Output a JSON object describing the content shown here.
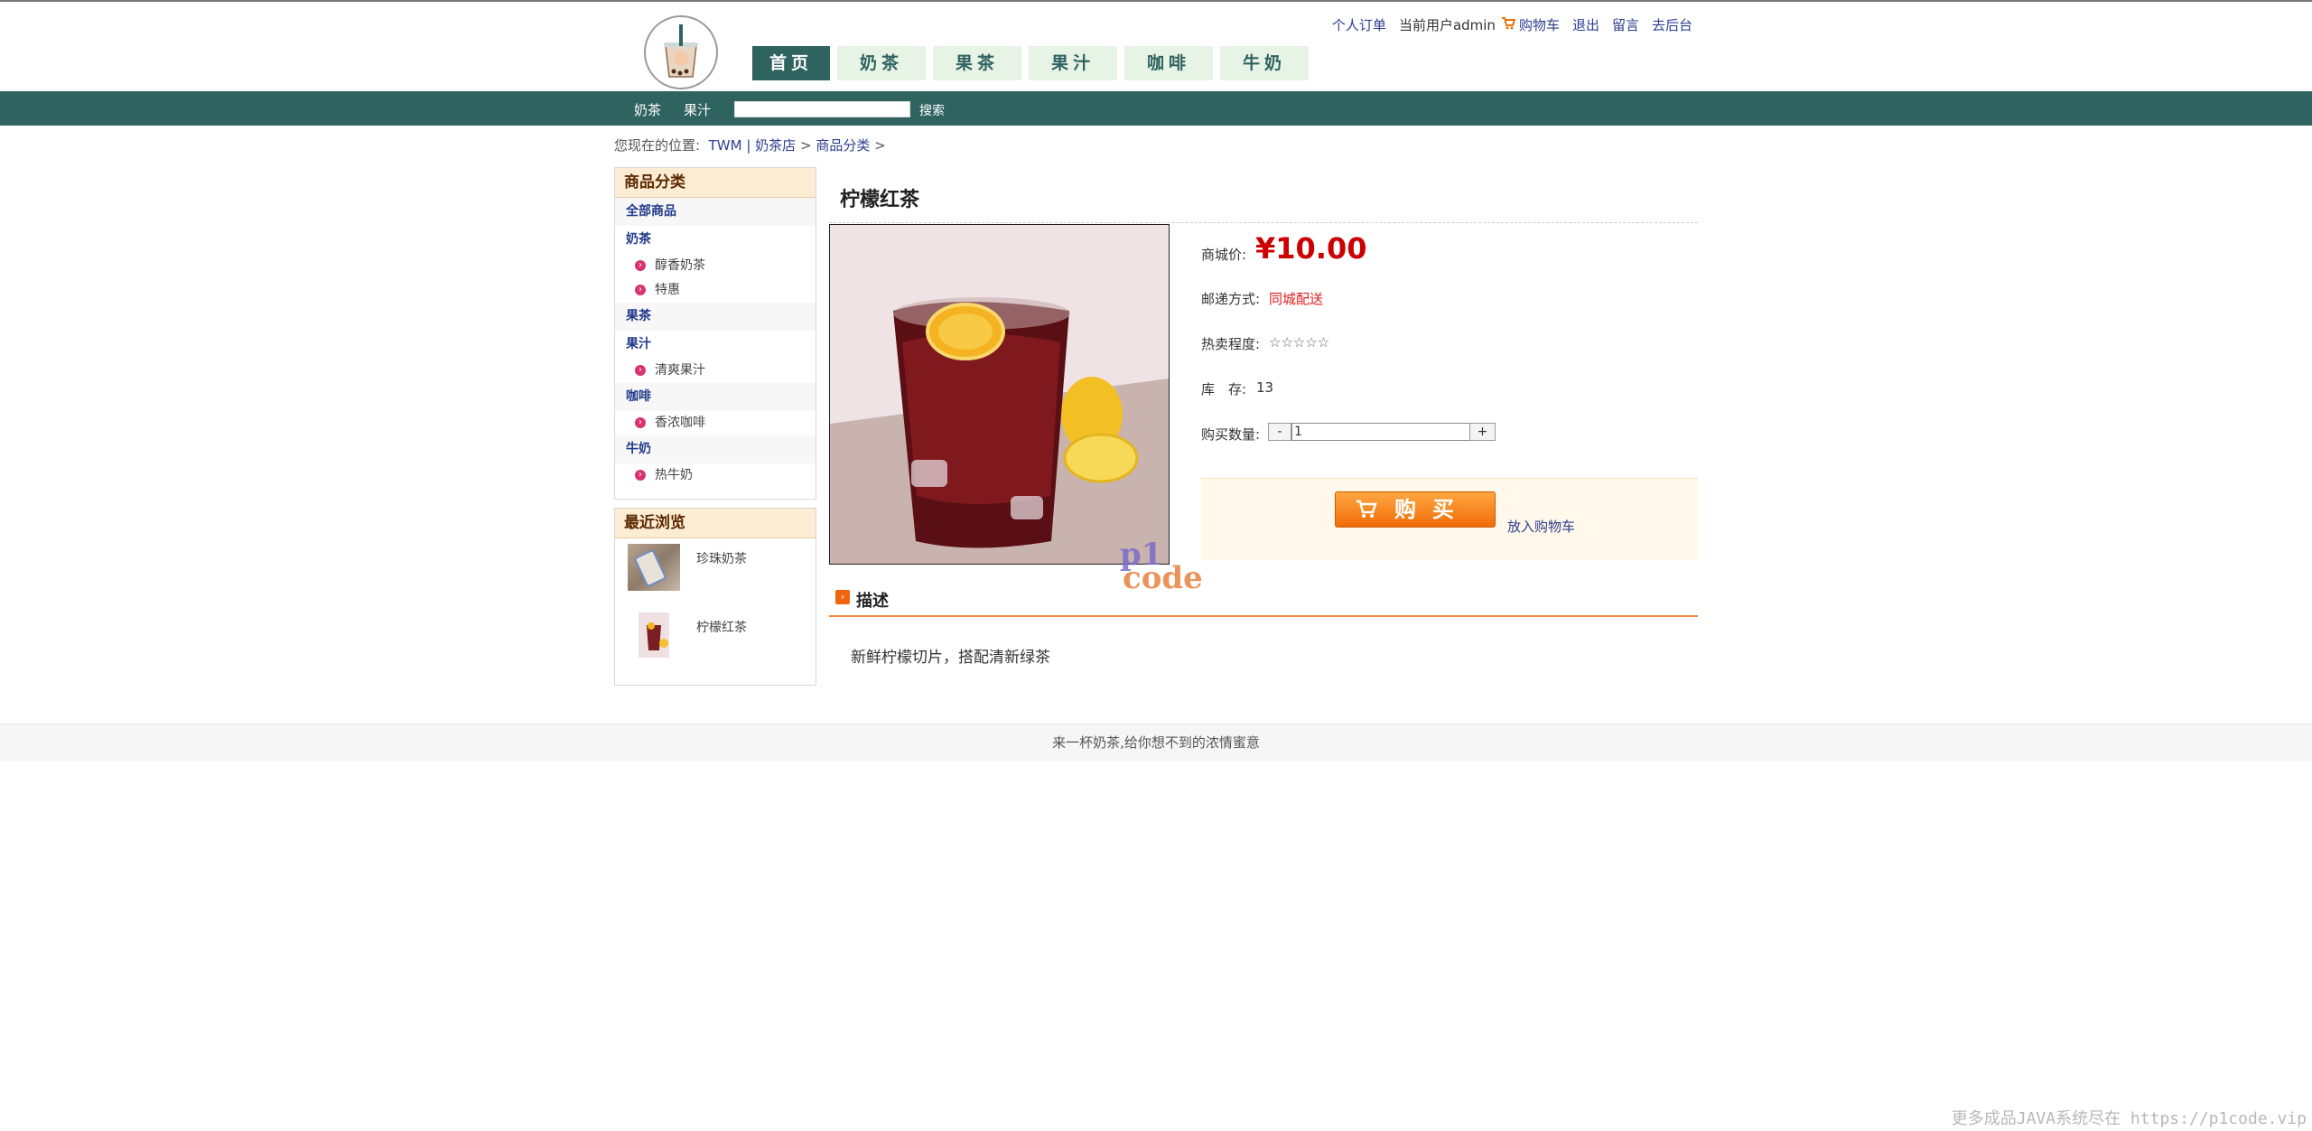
{
  "header": {
    "nav": [
      "首页",
      "奶茶",
      "果茶",
      "果汁",
      "咖啡",
      "牛奶"
    ],
    "links": {
      "orders": "个人订单",
      "current_user": "当前用户admin",
      "cart": "购物车",
      "logout": "退出",
      "message": "留言",
      "admin": "去后台"
    }
  },
  "searchbar": {
    "quick": [
      "奶茶",
      "果汁"
    ],
    "input_value": "",
    "button": "搜索"
  },
  "breadcrumb": {
    "prefix": "您现在的位置:",
    "items": [
      "TWM",
      "奶茶店",
      "商品分类"
    ],
    "sep1": "|",
    "sep": ">"
  },
  "sidebar": {
    "category_title": "商品分类",
    "categories": [
      {
        "label": "全部商品",
        "subs": []
      },
      {
        "label": "奶茶",
        "subs": [
          "醇香奶茶",
          "特惠"
        ]
      },
      {
        "label": "果茶",
        "subs": []
      },
      {
        "label": "果汁",
        "subs": [
          "清爽果汁"
        ]
      },
      {
        "label": "咖啡",
        "subs": [
          "香浓咖啡"
        ]
      },
      {
        "label": "牛奶",
        "subs": [
          "热牛奶"
        ]
      }
    ],
    "recent_title": "最近浏览",
    "recent": [
      {
        "name": "珍珠奶茶"
      },
      {
        "name": "柠檬红茶"
      }
    ]
  },
  "product": {
    "title": "柠檬红茶",
    "price_label": "商城价:",
    "price": "¥10.00",
    "shipping_label": "邮递方式:",
    "shipping": "同城配送",
    "hot_label": "热卖程度:",
    "hot": "☆☆☆☆☆",
    "stock_label": "库　存:",
    "stock": "13",
    "qty_label": "购买数量:",
    "qty_minus": "-",
    "qty_plus": "+",
    "qty_value": "1",
    "buy": "购买",
    "add_cart": "放入购物车"
  },
  "description": {
    "title": "描述",
    "text": "新鲜柠檬切片，搭配清新绿茶"
  },
  "watermark": {
    "line1": "p1",
    "line2": "code"
  },
  "footer": {
    "text": "来一杯奶茶,给你想不到的浓情蜜意",
    "corner": "更多成品JAVA系统尽在 https://p1code.vip"
  },
  "colors": {
    "theme": "#2f6360",
    "nav_tab": "#e6f3e5",
    "link": "#2c3f8f",
    "price": "#cc0000",
    "accent": "#f06d0a"
  }
}
